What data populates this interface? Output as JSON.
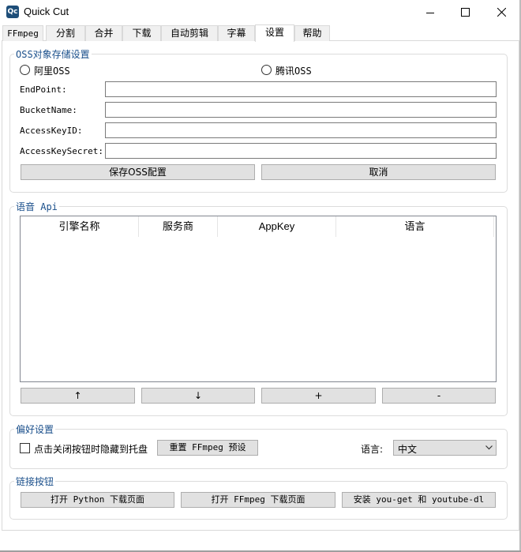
{
  "window": {
    "title": "Quick Cut",
    "app_icon_text": "Qc"
  },
  "tabs": [
    {
      "label": "FFmpeg"
    },
    {
      "label": "分割"
    },
    {
      "label": "合并"
    },
    {
      "label": "下载"
    },
    {
      "label": "自动剪辑"
    },
    {
      "label": "字幕"
    },
    {
      "label": "设置",
      "active": true
    },
    {
      "label": "帮助"
    }
  ],
  "oss": {
    "group_title": "OSS对象存储设置",
    "radio_aliyun": "阿里OSS",
    "radio_tencent": "腾讯OSS",
    "endpoint_label": "EndPoint:",
    "endpoint_value": "",
    "bucket_label": "BucketName:",
    "bucket_value": "",
    "keyid_label": "AccessKeyID:",
    "keyid_value": "",
    "secret_label": "AccessKeySecret:",
    "secret_value": "",
    "save_button": "保存OSS配置",
    "cancel_button": "取消"
  },
  "api": {
    "group_title": "语音 Api",
    "columns": [
      "引擎名称",
      "服务商",
      "AppKey",
      "语言"
    ],
    "rows": [],
    "up_button": "↑",
    "down_button": "↓",
    "add_button": "+",
    "remove_button": "-"
  },
  "prefs": {
    "group_title": "偏好设置",
    "hide_to_tray_label": "点击关闭按钮时隐藏到托盘",
    "hide_to_tray_checked": false,
    "reset_button": "重置 FFmpeg 预设",
    "language_label": "语言:",
    "language_value": "中文"
  },
  "links": {
    "group_title": "链接按钮",
    "python_button": "打开 Python 下载页面",
    "ffmpeg_button": "打开 FFmpeg 下载页面",
    "install_button": "安装 you-get 和 youtube-dl"
  },
  "colors": {
    "group_title": "#1a4f8b",
    "button_bg": "#e1e1e1",
    "input_border": "#7a7a7a"
  }
}
